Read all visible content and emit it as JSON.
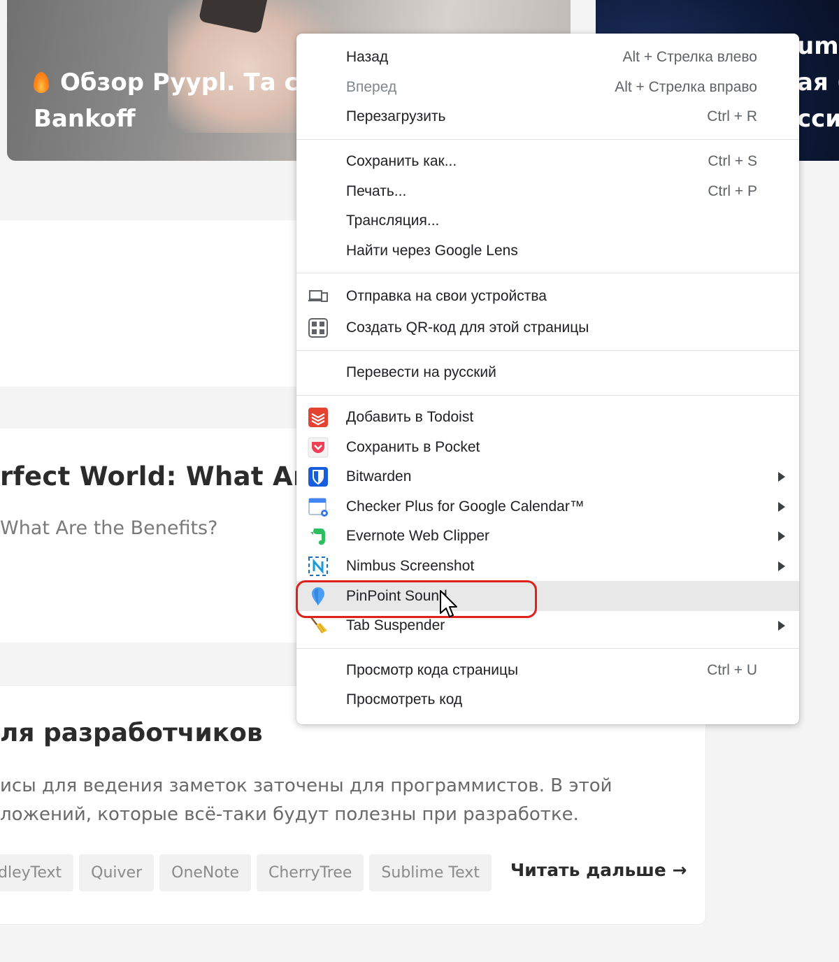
{
  "background": {
    "hero_left_title_line1": "Обзор Pyypl. Та с",
    "hero_left_title_line2": "Bankoff",
    "hero_right_line1": "um.",
    "hero_right_line2": "ая (",
    "hero_right_line3": "сси",
    "article_b_title": "rfect World: What Are t",
    "article_b_subtitle": "What Are the Benefits?",
    "article_c_title": "ля разработчиков",
    "article_c_desc_line1": "исы для ведения заметок заточены для программистов. В этой",
    "article_c_desc_line2": "ложений, которые всё-таки будут полезны при разработке.",
    "tags": [
      "dleyText",
      "Quiver",
      "OneNote",
      "CherryTree",
      "Sublime Text"
    ],
    "read_more": "Читать дальше →"
  },
  "context_menu": {
    "nav": [
      {
        "label": "Назад",
        "shortcut": "Alt + Стрелка влево"
      },
      {
        "label": "Вперед",
        "shortcut": "Alt + Стрелка вправо"
      },
      {
        "label": "Перезагрузить",
        "shortcut": "Ctrl + R"
      }
    ],
    "page": [
      {
        "label": "Сохранить как...",
        "shortcut": "Ctrl + S"
      },
      {
        "label": "Печать...",
        "shortcut": "Ctrl + P"
      },
      {
        "label": "Трансляция..."
      },
      {
        "label": "Найти через Google Lens"
      }
    ],
    "share": [
      {
        "label": "Отправка на свои устройства",
        "icon": "devices-icon"
      },
      {
        "label": "Создать QR-код для этой страницы",
        "icon": "qr-code-icon"
      }
    ],
    "translate": {
      "label": "Перевести на русский"
    },
    "extensions": [
      {
        "label": "Добавить в Todoist",
        "icon": "todoist-icon"
      },
      {
        "label": "Сохранить в Pocket",
        "icon": "pocket-icon"
      },
      {
        "label": "Bitwarden",
        "icon": "bitwarden-icon",
        "submenu": true
      },
      {
        "label": "Checker Plus for Google Calendar™",
        "icon": "calendar-icon",
        "submenu": true
      },
      {
        "label": "Evernote Web Clipper",
        "icon": "evernote-icon",
        "submenu": true
      },
      {
        "label": "Nimbus Screenshot",
        "icon": "nimbus-icon",
        "submenu": true
      },
      {
        "label": "PinPoint Sound",
        "icon": "pinpoint-icon",
        "highlighted": true
      },
      {
        "label": "Tab Suspender",
        "icon": "broom-icon",
        "submenu": true
      }
    ],
    "dev": [
      {
        "label": "Просмотр кода страницы",
        "shortcut": "Ctrl + U"
      },
      {
        "label": "Просмотреть код"
      }
    ]
  },
  "colors": {
    "annotation": "#e0201b",
    "highlight": "#e8e8e8"
  }
}
